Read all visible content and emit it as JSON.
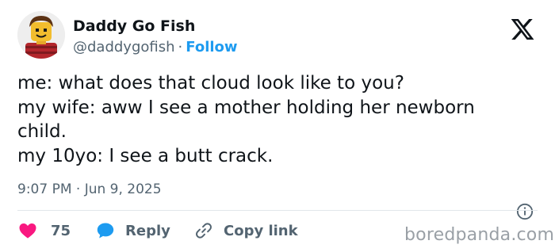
{
  "tweet": {
    "author": {
      "name": "Daddy Go Fish",
      "handle": "@daddygofish",
      "separator": "·",
      "follow_label": "Follow",
      "avatar_icon": "lego-minifigure-avatar"
    },
    "text_lines": [
      "me: what does that cloud look like to you?",
      "my wife: aww I see a mother holding her newborn",
      "child.",
      "my 10yo: I see a butt crack."
    ],
    "timestamp": "9:07 PM · Jun 9, 2025",
    "actions": {
      "like_count": "75",
      "reply_label": "Reply",
      "copy_link_label": "Copy link"
    },
    "icons": {
      "brand": "x-logo-icon",
      "info": "info-icon",
      "like": "heart-icon",
      "reply": "speech-bubble-icon",
      "copy": "link-icon"
    }
  },
  "watermark": "boredpanda.com",
  "colors": {
    "follow": "#1d9bf0",
    "heart": "#f91880",
    "reply_bubble": "#1d9bf0",
    "muted": "#536471"
  }
}
